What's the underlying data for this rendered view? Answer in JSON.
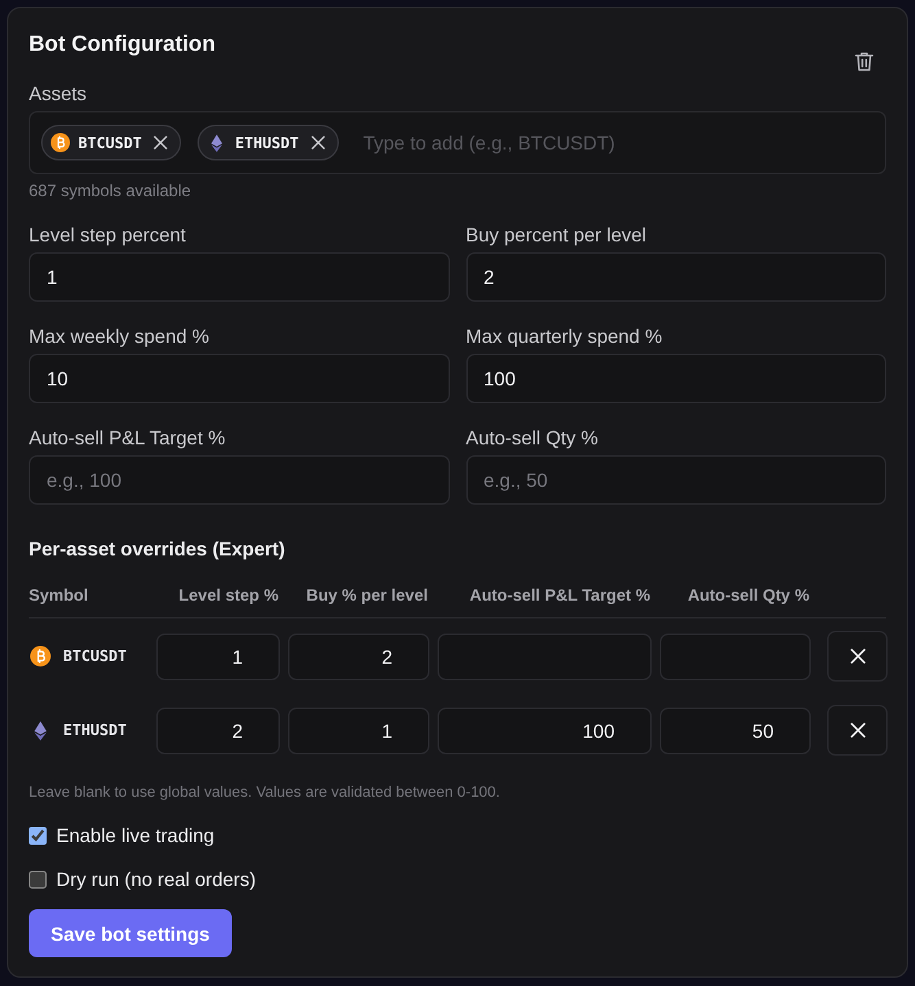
{
  "title": "Bot Configuration",
  "assets": {
    "label": "Assets",
    "chips": [
      {
        "symbol": "BTCUSDT",
        "kind": "btc"
      },
      {
        "symbol": "ETHUSDT",
        "kind": "eth"
      }
    ],
    "placeholder": "Type to add (e.g., BTCUSDT)",
    "hint": "687 symbols available"
  },
  "fields": [
    {
      "label": "Level step percent",
      "value": "1"
    },
    {
      "label": "Buy percent per level",
      "value": "2"
    },
    {
      "label": "Max weekly spend %",
      "value": "10"
    },
    {
      "label": "Max quarterly spend %",
      "value": "100"
    },
    {
      "label": "Auto-sell P&L Target %",
      "placeholder": "e.g., 100"
    },
    {
      "label": "Auto-sell Qty %",
      "placeholder": "e.g., 50"
    }
  ],
  "overrides": {
    "title": "Per-asset overrides (Expert)",
    "columns": [
      "Symbol",
      "Level step %",
      "Buy % per level",
      "Auto-sell P&L Target %",
      "Auto-sell Qty %"
    ],
    "rows": [
      {
        "symbol": "BTCUSDT",
        "kind": "btc",
        "level_step": "1",
        "buy_percent": "2"
      },
      {
        "symbol": "ETHUSDT",
        "kind": "eth",
        "level_step": "2",
        "buy_percent": "1",
        "auto_sell_target": "100",
        "auto_sell_qty": "50"
      }
    ],
    "note": "Leave blank to use global values. Values are validated between 0-100."
  },
  "checkboxes": [
    {
      "label": "Enable live trading",
      "checked": true
    },
    {
      "label": "Dry run (no real orders)",
      "checked": false
    }
  ],
  "save_button": "Save bot settings"
}
